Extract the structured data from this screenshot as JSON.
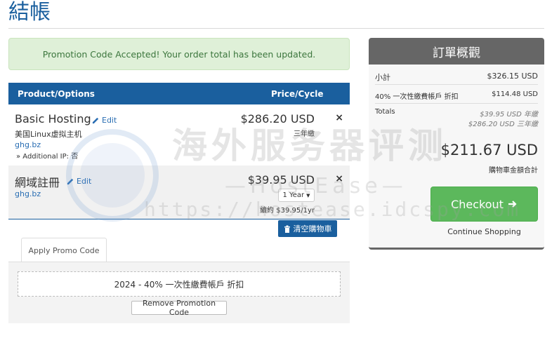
{
  "page": {
    "title": "結帳"
  },
  "alert": {
    "text": "Promotion Code Accepted! Your order total has been updated."
  },
  "cart": {
    "headers": {
      "product": "Product/Options",
      "price": "Price/Cycle"
    },
    "items": [
      {
        "name": "Basic Hosting",
        "edit_label": "Edit",
        "description": "美国Linux虚拟主机",
        "domain": "ghg.bz",
        "option": "» Additional IP: 否",
        "price": "$286.20 USD",
        "cycle": "三年繳",
        "remove": "×"
      },
      {
        "name": "網域註冊",
        "edit_label": "Edit",
        "domain": "ghg.bz",
        "price": "$39.95 USD",
        "period_select": "1 Year",
        "renewal": "續約 $39.95/1yr",
        "remove": "×"
      }
    ],
    "empty_cart_label": "清空購物車"
  },
  "promo": {
    "tab_label": "Apply Promo Code",
    "applied_code": "2024 - 40% 一次性繳費帳戶 折扣",
    "remove_label": "Remove Promotion Code"
  },
  "summary": {
    "title": "訂單概觀",
    "subtotal_label": "小計",
    "subtotal_value": "$326.15 USD",
    "discount_label": "40% 一次性繳費帳戶 折扣",
    "discount_value": "$114.48 USD",
    "totals_label": "Totals",
    "totals_lines": [
      "$39.95 USD 年繳",
      "$286.20 USD 三年繳"
    ],
    "grand_total": "$211.67 USD",
    "grand_total_label": "購物車金額合計",
    "checkout_label": "Checkout",
    "continue_label": "Continue Shopping"
  },
  "watermark": {
    "cn": "海外服务器评测",
    "en": "—HostEase—",
    "url": "https://hostease.idcspy.com"
  },
  "colors": {
    "primary": "#1a5f9e",
    "success": "#5cb85c",
    "summary_head": "#666666"
  }
}
